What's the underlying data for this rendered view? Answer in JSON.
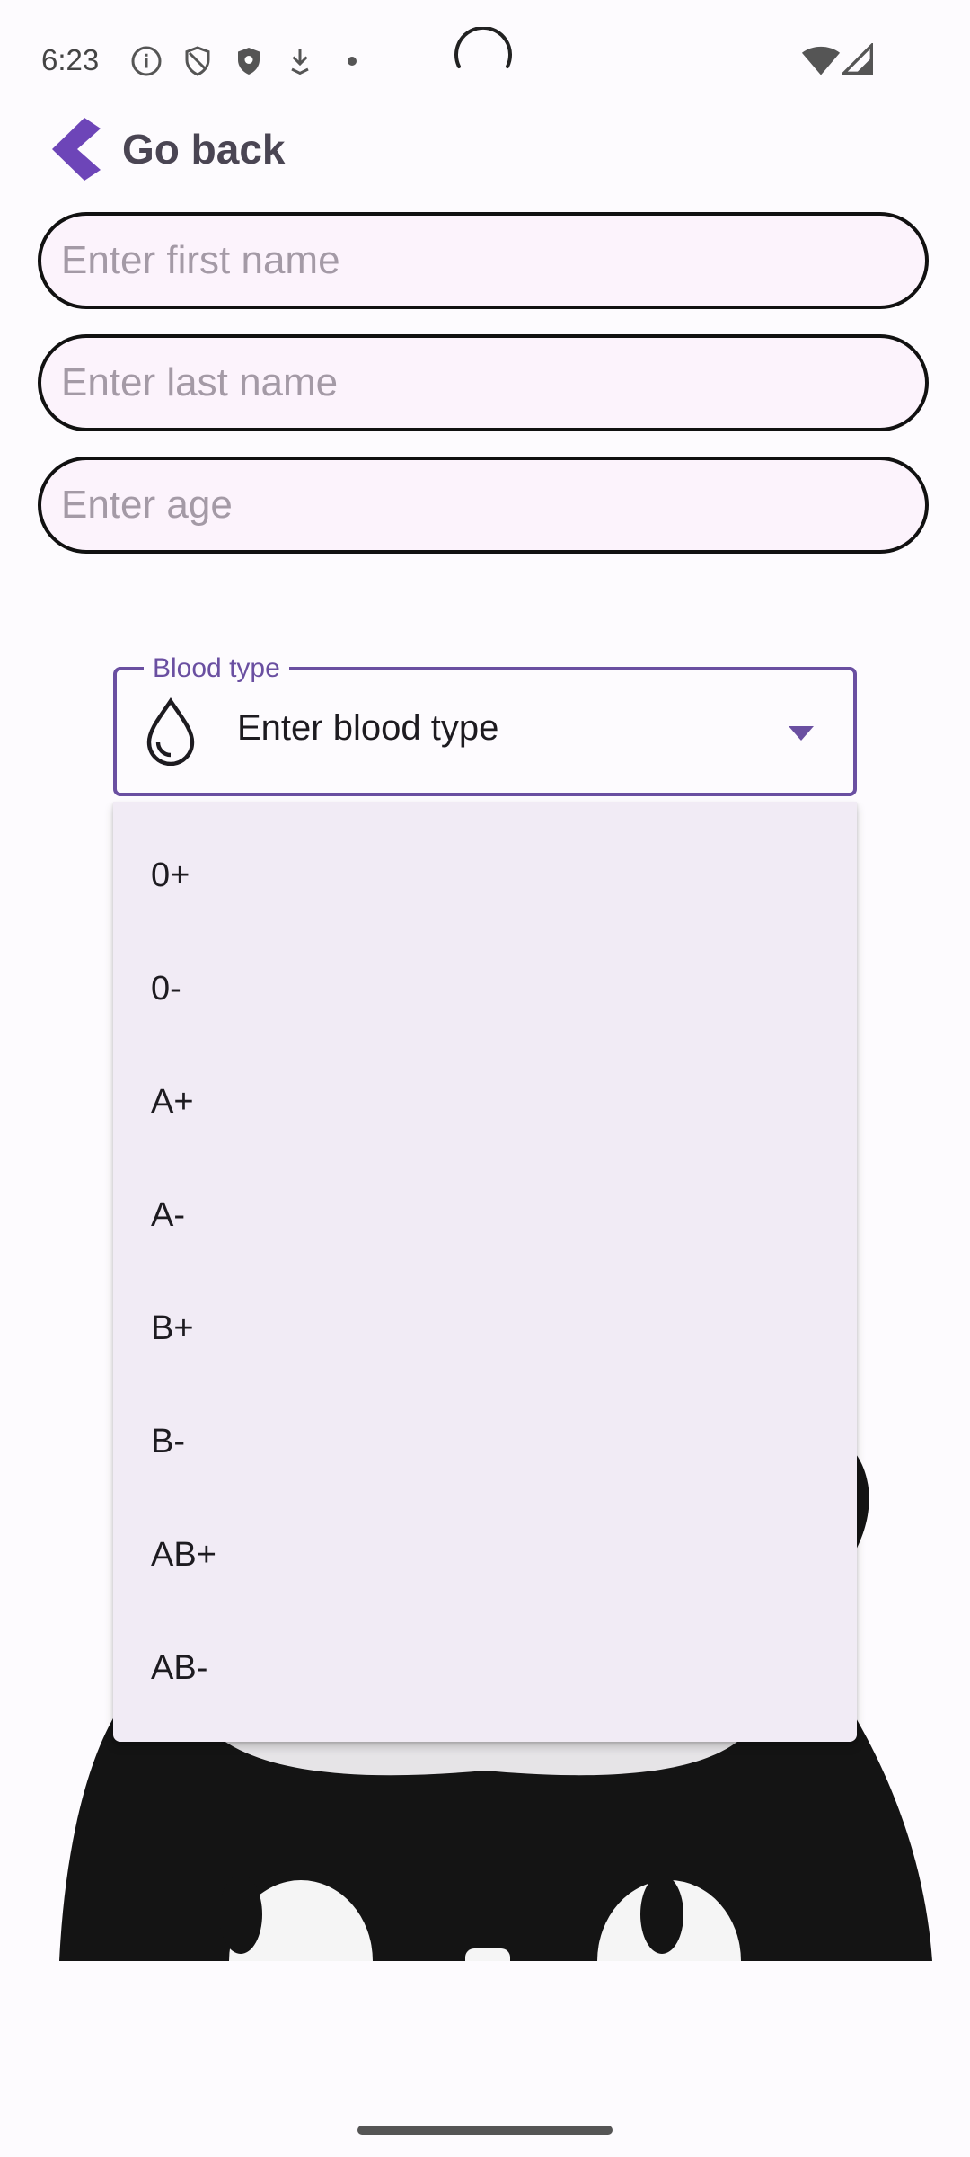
{
  "status_bar": {
    "time": "6:23",
    "left_icons": [
      "info-icon",
      "shield-outline-icon",
      "shield-filled-icon",
      "download-icon",
      "dot-icon"
    ],
    "right_icons": [
      "wifi-icon",
      "cellular-signal-icon"
    ]
  },
  "nav": {
    "back_label": "Go back",
    "back_icon": "chevron-left-icon"
  },
  "form": {
    "first_name": {
      "value": "",
      "placeholder": "Enter first name"
    },
    "last_name": {
      "value": "",
      "placeholder": "Enter last name"
    },
    "age": {
      "value": "",
      "placeholder": "Enter age"
    }
  },
  "blood_type": {
    "label": "Blood type",
    "value": "Enter blood type",
    "leading_icon": "water-drop-icon",
    "trailing_icon": "dropdown-arrow-icon",
    "expanded": true,
    "options": [
      "0+",
      "0-",
      "A+",
      "A-",
      "B+",
      "B-",
      "AB+",
      "AB-"
    ]
  },
  "colors": {
    "accent": "#6a4fa1",
    "back_chevron": "#6d45b8",
    "field_fill": "#fcf3fc",
    "menu_fill": "#f1ebf5"
  }
}
